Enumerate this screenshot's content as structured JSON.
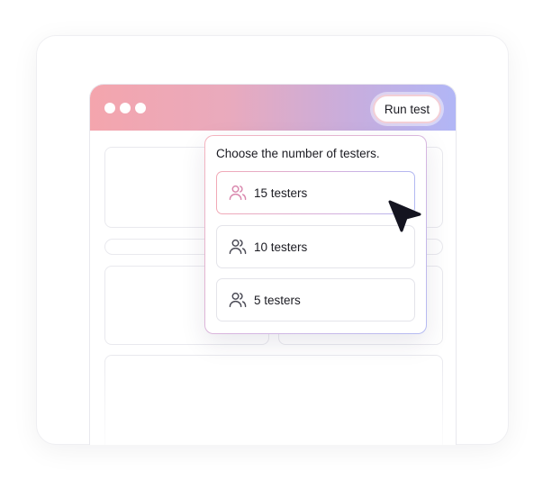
{
  "window": {
    "run_button_label": "Run test"
  },
  "popup": {
    "title": "Choose the number of testers.",
    "options": [
      {
        "label": "15 testers",
        "icon": "users-icon",
        "selected": true
      },
      {
        "label": "10 testers",
        "icon": "users-icon",
        "selected": false
      },
      {
        "label": "5 testers",
        "icon": "users-icon",
        "selected": false
      }
    ]
  },
  "colors": {
    "header_gradient_start": "#f4a5ad",
    "header_gradient_end": "#b1b6f6",
    "selected_icon": "#d987ad",
    "default_icon": "#4a4a55",
    "cursor": "#141420"
  }
}
